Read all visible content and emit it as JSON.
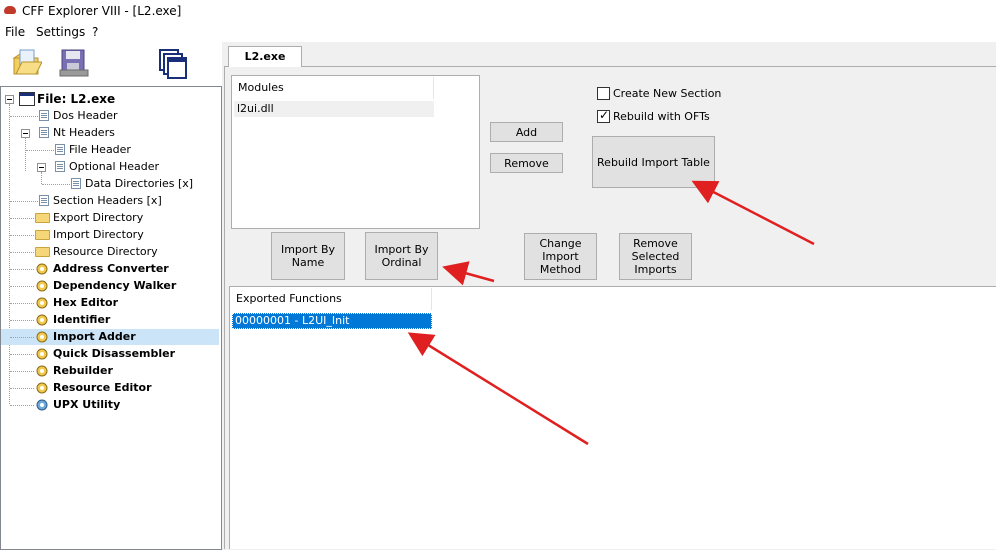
{
  "window": {
    "title": "CFF Explorer VIII - [L2.exe]"
  },
  "menu": {
    "items": [
      "File",
      "Settings",
      "?"
    ]
  },
  "tree": {
    "items": [
      {
        "label": "File: L2.exe",
        "bold": true
      },
      {
        "label": "Dos Header"
      },
      {
        "label": "Nt Headers"
      },
      {
        "label": "File Header"
      },
      {
        "label": "Optional Header"
      },
      {
        "label": "Data Directories [x]"
      },
      {
        "label": "Section Headers [x]"
      },
      {
        "label": "Export Directory"
      },
      {
        "label": "Import Directory"
      },
      {
        "label": "Resource Directory"
      },
      {
        "label": "Address Converter",
        "bold": true
      },
      {
        "label": "Dependency Walker",
        "bold": true
      },
      {
        "label": "Hex Editor",
        "bold": true
      },
      {
        "label": "Identifier",
        "bold": true
      },
      {
        "label": "Import Adder",
        "bold": true,
        "selected": true
      },
      {
        "label": "Quick Disassembler",
        "bold": true
      },
      {
        "label": "Rebuilder",
        "bold": true
      },
      {
        "label": "Resource Editor",
        "bold": true
      },
      {
        "label": "UPX Utility",
        "bold": true
      }
    ]
  },
  "tab": {
    "label": "L2.exe"
  },
  "modules": {
    "header": "Modules",
    "rows": [
      "l2ui.dll"
    ]
  },
  "buttons": {
    "add": "Add",
    "remove": "Remove",
    "rebuild_import_table": "Rebuild Import Table",
    "import_by_name": "Import By\nName",
    "import_by_ordinal": "Import By\nOrdinal",
    "change_import_method": "Change\nImport\nMethod",
    "remove_selected_imports": "Remove\nSelected\nImports"
  },
  "options": {
    "create_new_section": {
      "label": "Create New Section",
      "checked": false
    },
    "rebuild_with_ofts": {
      "label": "Rebuild with OFTs",
      "checked": true
    }
  },
  "exported_functions": {
    "header": "Exported Functions",
    "rows": [
      "00000001 - L2UI_Init"
    ]
  },
  "colors": {
    "selection": "#0078d7",
    "tree_selected": "#cce4f7",
    "arrow": "#e02020"
  }
}
